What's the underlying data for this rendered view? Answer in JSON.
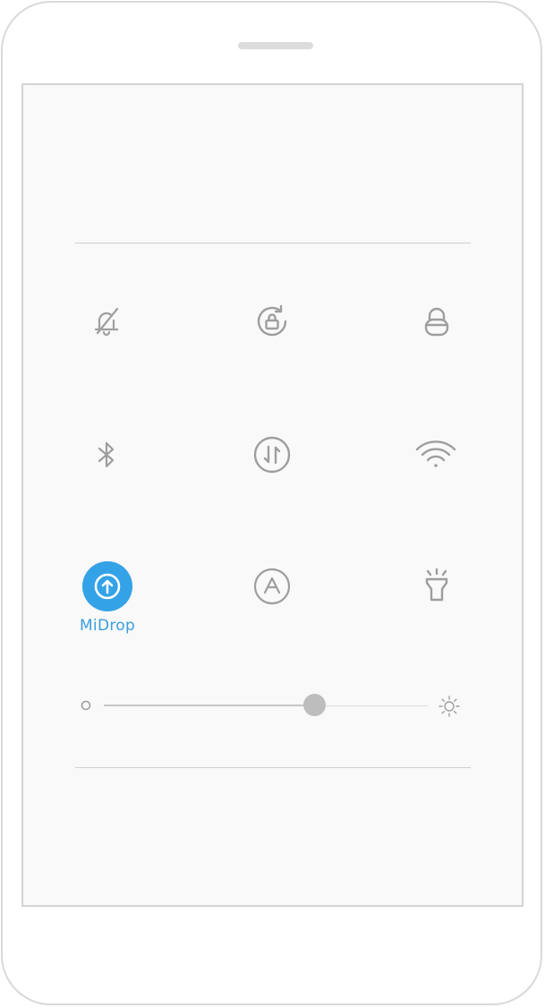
{
  "control_center": {
    "tiles": [
      {
        "icon": "bell-off-icon",
        "label": "",
        "active": false
      },
      {
        "icon": "rotation-lock-icon",
        "label": "",
        "active": false
      },
      {
        "icon": "lock-icon",
        "label": "",
        "active": false
      },
      {
        "icon": "bluetooth-icon",
        "label": "",
        "active": false
      },
      {
        "icon": "mobile-data-icon",
        "label": "",
        "active": false
      },
      {
        "icon": "wifi-icon",
        "label": "",
        "active": false
      },
      {
        "icon": "midrop-icon",
        "label": "MiDrop",
        "active": true
      },
      {
        "icon": "auto-brightness-icon",
        "label": "",
        "active": false
      },
      {
        "icon": "flashlight-icon",
        "label": "",
        "active": false
      }
    ],
    "brightness": {
      "level": 0.65,
      "low_icon": "brightness-low-icon",
      "high_icon": "brightness-high-icon"
    }
  },
  "colors": {
    "accent": "#34a2e6",
    "accent_text": "#3a9ee0",
    "icon_inactive": "#9e9e9e",
    "screen_bg": "#f9f9f9"
  }
}
